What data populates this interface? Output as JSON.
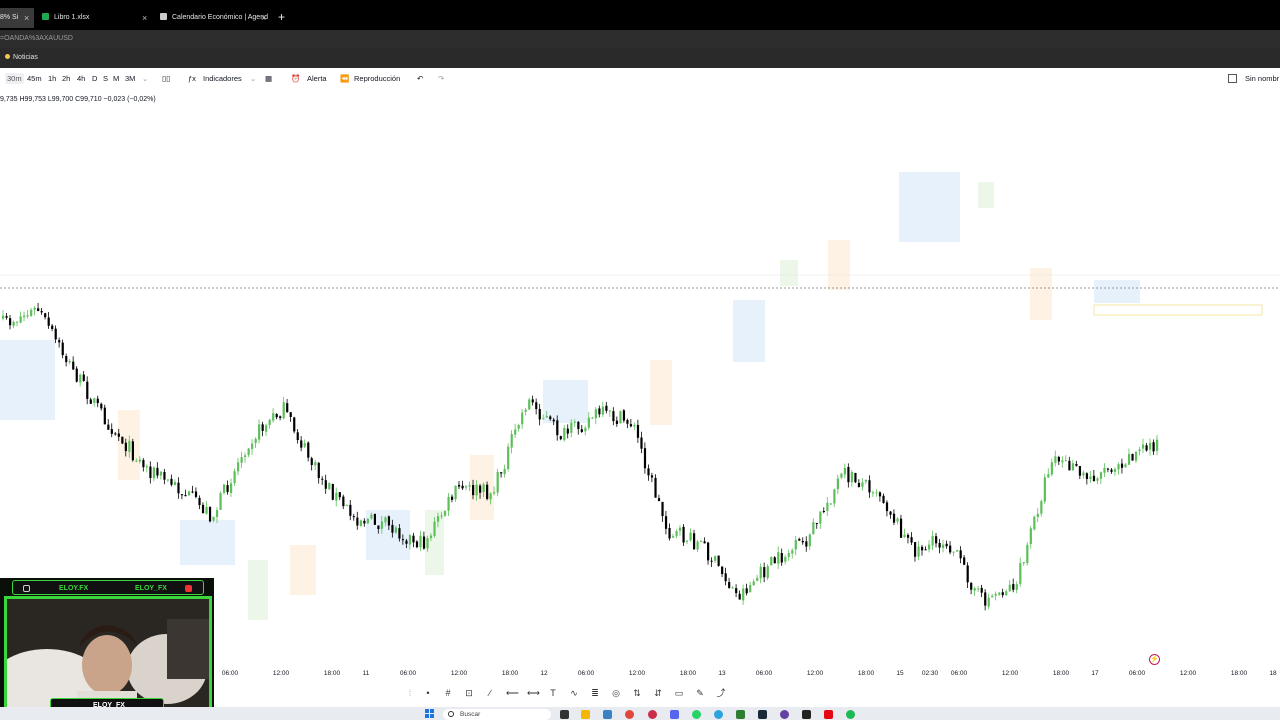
{
  "browser": {
    "tabs": [
      {
        "label": "8% Si",
        "active": true
      },
      {
        "label": "Libro 1.xlsx",
        "active": false
      },
      {
        "label": "Calendario Económico | Agend",
        "active": false
      }
    ],
    "new_tab": "+",
    "url": "=OANDA%3AXAUUSD",
    "bookmark": "Noticias"
  },
  "toolbar": {
    "intervals": [
      "30m",
      "45m",
      "1h",
      "2h",
      "4h",
      "D",
      "S",
      "M",
      "3M"
    ],
    "selected_interval": "30m",
    "indicators_label": "Indicadores",
    "alert_label": "Alerta",
    "replay_label": "Reproducción",
    "right_label": "Sin nombr"
  },
  "legend": {
    "ohlc": "9,735  H99,753  L99,700  C99,710  −0,023 (−0,02%)"
  },
  "time_axis": [
    "06:00",
    "12:00",
    "18:00",
    "11",
    "06:00",
    "12:00",
    "18:00",
    "12",
    "06:00",
    "12:00",
    "18:00",
    "13",
    "06:00",
    "12:00",
    "18:00",
    "15",
    "02:30",
    "06:00",
    "12:00",
    "18:00",
    "17",
    "06:00",
    "12:00",
    "18:00",
    "18"
  ],
  "webcam": {
    "handle_left": "ELOY.FX",
    "handle_right": "ELOY_FX",
    "name_bottom": "ELOY_FX"
  },
  "taskbar": {
    "search_placeholder": "Buscar"
  },
  "colors": {
    "up_candle": "#5cbf5a",
    "down_candle": "#000000",
    "zone_blue": "#e3f0fc",
    "zone_orange": "#fdf1e0",
    "zone_green": "#eaf6e7",
    "accent_green": "#3bd63b"
  },
  "chart_data": {
    "type": "candlestick",
    "symbol": "OANDA:XAUUSD",
    "interval": "30m",
    "x": [
      "10 06:00",
      "10 12:00",
      "10 18:00",
      "11",
      "11 06:00",
      "11 12:00",
      "11 18:00",
      "12",
      "12 06:00",
      "12 12:00",
      "12 18:00",
      "13",
      "13 06:00",
      "13 12:00",
      "13 18:00",
      "15",
      "15 02:30",
      "15 06:00",
      "15 12:00",
      "15 18:00",
      "17",
      "17 06:00"
    ],
    "close_path_relative": [
      0.37,
      0.34,
      0.47,
      0.58,
      0.67,
      0.72,
      0.78,
      0.62,
      0.55,
      0.69,
      0.78,
      0.8,
      0.84,
      0.72,
      0.73,
      0.53,
      0.61,
      0.56,
      0.58,
      0.81,
      0.84,
      0.95,
      0.88,
      0.83,
      0.69,
      0.72,
      0.85,
      0.83,
      0.96,
      0.92,
      0.65,
      0.7,
      0.66,
      0.62
    ],
    "grid": false,
    "price_line": "dashed horizontal"
  }
}
